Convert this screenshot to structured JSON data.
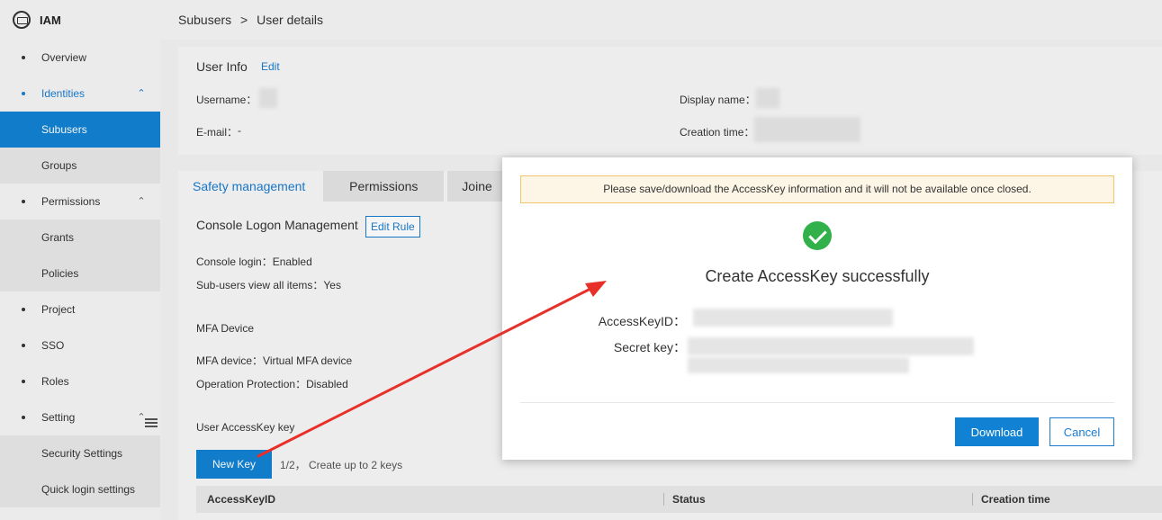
{
  "app": {
    "name": "IAM"
  },
  "sidebar": {
    "items": [
      {
        "label": "Overview"
      },
      {
        "label": "Identities"
      },
      {
        "label": "Subusers"
      },
      {
        "label": "Groups"
      },
      {
        "label": "Permissions"
      },
      {
        "label": "Grants"
      },
      {
        "label": "Policies"
      },
      {
        "label": "Project"
      },
      {
        "label": "SSO"
      },
      {
        "label": "Roles"
      },
      {
        "label": "Setting"
      },
      {
        "label": "Security Settings"
      },
      {
        "label": "Quick login settings"
      }
    ]
  },
  "breadcrumb": {
    "parent": "Subusers",
    "separator": ">",
    "current": "User details"
  },
  "user_info": {
    "title": "User Info",
    "edit_label": "Edit",
    "username_label": "Username：",
    "display_name_label": "Display name：",
    "email_label": "E-mail：",
    "email_value": "-",
    "creation_time_label": "Creation time："
  },
  "tabs": [
    {
      "label": "Safety management"
    },
    {
      "label": "Permissions"
    },
    {
      "label": "Joine"
    }
  ],
  "console_logon": {
    "title": "Console Logon Management",
    "edit_rule_label": "Edit Rule",
    "console_login": "Console login：Enabled",
    "subusers_view": "Sub-users view all items：Yes"
  },
  "mfa": {
    "title": "MFA Device",
    "device": "MFA device：Virtual MFA device",
    "operation_protection": "Operation Protection：Disabled"
  },
  "access_keys": {
    "title": "User AccessKey key",
    "new_key_label": "New Key",
    "count_text": "1/2， Create up to 2 keys",
    "columns": [
      "AccessKeyID",
      "Status",
      "Creation time"
    ]
  },
  "modal": {
    "notice": "Please save/download the AccessKey information and it will not be available once closed.",
    "title": "Create AccessKey successfully",
    "access_key_id_label": "AccessKeyID：",
    "secret_key_label": "Secret key：",
    "download_label": "Download",
    "cancel_label": "Cancel"
  },
  "colors": {
    "primary": "#1182d3",
    "link": "#1a7bd0",
    "success": "#32b04a",
    "notice_bg": "#fdf5e6",
    "notice_border": "#f0c36d",
    "annotation_arrow": "#e8302a"
  }
}
